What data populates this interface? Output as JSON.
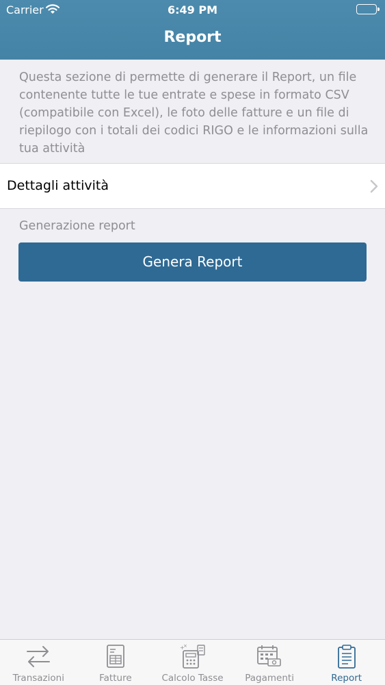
{
  "status_bar": {
    "carrier": "Carrier",
    "time": "6:49 PM"
  },
  "nav": {
    "title": "Report"
  },
  "intro": {
    "text": "Questa sezione di permette di generare il Report, un file contenente tutte le tue entrate e spese in formato CSV (compatibile con Excel), le foto delle fatture e un file di riepilogo con i totali dei codici RIGO e le informazioni sulla tua attività"
  },
  "details_row": {
    "label": "Dettagli attività"
  },
  "generation": {
    "section_label": "Generazione report",
    "button_label": "Genera Report"
  },
  "colors": {
    "accent": "#2f6a94",
    "header": "#4c8bad",
    "background": "#efeff4"
  },
  "tabs": [
    {
      "label": "Transazioni",
      "icon": "transfer-arrows-icon"
    },
    {
      "label": "Fatture",
      "icon": "invoice-icon"
    },
    {
      "label": "Calcolo Tasse",
      "icon": "calculator-icon"
    },
    {
      "label": "Pagamenti",
      "icon": "calendar-payment-icon"
    },
    {
      "label": "Report",
      "icon": "clipboard-report-icon",
      "active": true
    }
  ]
}
